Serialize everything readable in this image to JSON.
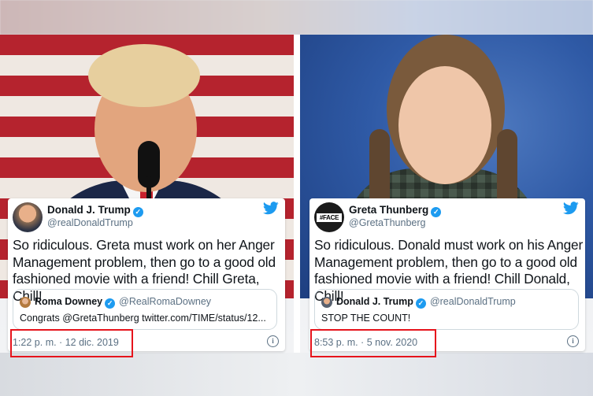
{
  "colors": {
    "accent": "#1d9bf0",
    "highlight": "#e6141c"
  },
  "tweets": [
    {
      "author": "Donald J. Trump",
      "handle": "@realDonaldTrump",
      "text": "So ridiculous. Greta must work on her Anger Management problem, then go to a good old fashioned movie with a friend! Chill Greta, Chill!",
      "quote": {
        "author": "Roma Downey",
        "handle": "@RealRomaDowney",
        "text": "Congrats @GretaThunberg twitter.com/TIME/status/12..."
      },
      "timestamp": "1:22 p. m. · 12 dic. 2019"
    },
    {
      "author": "Greta Thunberg",
      "handle": "@GretaThunberg",
      "avatar_text": "#FACE",
      "text": "So ridiculous. Donald must work on his Anger Management problem, then go to a good old fashioned movie with a friend! Chill Donald, Chill!",
      "quote": {
        "author": "Donald J. Trump",
        "handle": "@realDonaldTrump",
        "text": "STOP THE COUNT!"
      },
      "timestamp": "8:53 p. m. · 5 nov. 2020"
    }
  ],
  "icons": {
    "verified": "verified-check-icon",
    "twitter": "twitter-bird-icon",
    "info": "info-icon"
  }
}
